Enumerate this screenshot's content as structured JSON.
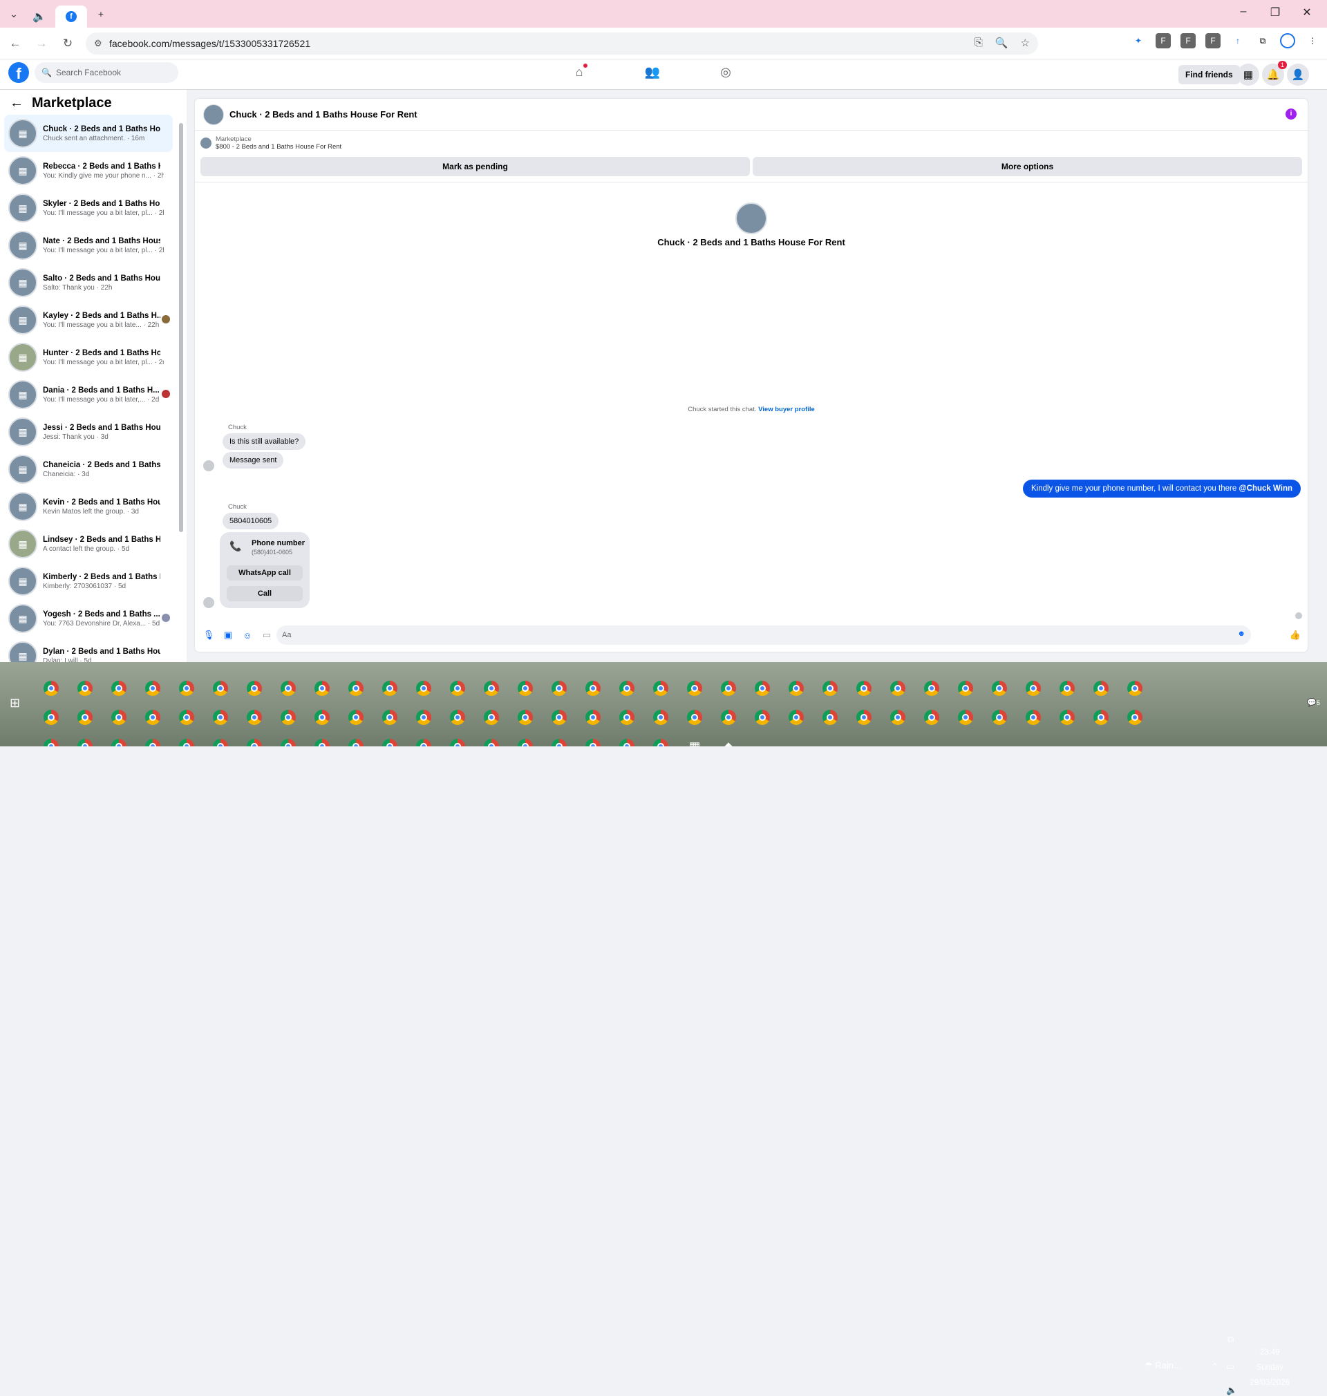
{
  "browser": {
    "url": "facebook.com/messages/t/1533005331726521"
  },
  "fb": {
    "search_placeholder": "Search Facebook",
    "find_friends": "Find friends",
    "notif_count": "1"
  },
  "sidebar": {
    "title": "Marketplace",
    "items": [
      {
        "name": "Chuck · 2 Beds and 1 Baths Hou...",
        "preview": "Chuck sent an attachment. · 16m"
      },
      {
        "name": "Rebecca · 2 Beds and 1 Baths H...",
        "preview": "You: Kindly give me your phone n... · 2h"
      },
      {
        "name": "Skyler · 2 Beds and 1 Baths Hou...",
        "preview": "You: I'll message you a bit later, pl... · 2h"
      },
      {
        "name": "Nate · 2 Beds and 1 Baths Hous...",
        "preview": "You: I'll message you a bit later, pl... · 2h"
      },
      {
        "name": "Salto · 2 Beds and 1 Baths Hous...",
        "preview": "Salto: Thank you · 22h"
      },
      {
        "name": "Kayley · 2 Beds and 1 Baths H...",
        "preview": "You: I'll message you a bit late... · 22h"
      },
      {
        "name": "Hunter · 2 Beds and 1 Baths Ho...",
        "preview": "You: I'll message you a bit later, pl... · 2d"
      },
      {
        "name": "Dania · 2 Beds and 1 Baths H...",
        "preview": "You: I'll message you a bit later,... · 2d"
      },
      {
        "name": "Jessi · 2 Beds and 1 Baths Hous...",
        "preview": "Jessi: Thank you · 3d"
      },
      {
        "name": "Chaneicia · 2 Beds and 1 Baths ...",
        "preview": "Chaneicia: · 3d"
      },
      {
        "name": "Kevin · 2 Beds and 1 Baths Hous...",
        "preview": "Kevin Matos left the group. · 3d"
      },
      {
        "name": "Lindsey · 2 Beds and 1 Baths Ho...",
        "preview": "A contact left the group. · 5d"
      },
      {
        "name": "Kimberly · 2 Beds and 1 Baths H...",
        "preview": "Kimberly: 2703061037 · 5d"
      },
      {
        "name": "Yogesh · 2 Beds and 1 Baths ...",
        "preview": "You: 7763 Devonshire Dr, Alexa... · 5d"
      },
      {
        "name": "Dylan · 2 Beds and 1 Baths Hou...",
        "preview": "Dylan: I will · 5d"
      }
    ]
  },
  "chat": {
    "title": "Chuck · 2 Beds and 1 Baths House For Rent",
    "marketplace_label": "Marketplace",
    "listing": "$800 - 2 Beds and 1 Baths House For Rent",
    "mark_pending": "Mark as pending",
    "more_options": "More options",
    "started_text": "Chuck started this chat.",
    "view_profile": "View buyer profile",
    "sender": "Chuck",
    "msg1": "Is this still available?",
    "msg2": "Message sent",
    "mine": "Kindly give me your phone number, I will contact you there",
    "mention": "@Chuck Winn",
    "msg3": "5804010605",
    "phone_title": "Phone number",
    "phone_sub": "(580)401-0605",
    "whatsapp": "WhatsApp call",
    "call": "Call",
    "composer_placeholder": "Aa"
  },
  "taskbar": {
    "time": "23:49",
    "day": "Sunday",
    "date": "29/03/2026",
    "weather": "Rain...",
    "notif": "5"
  }
}
